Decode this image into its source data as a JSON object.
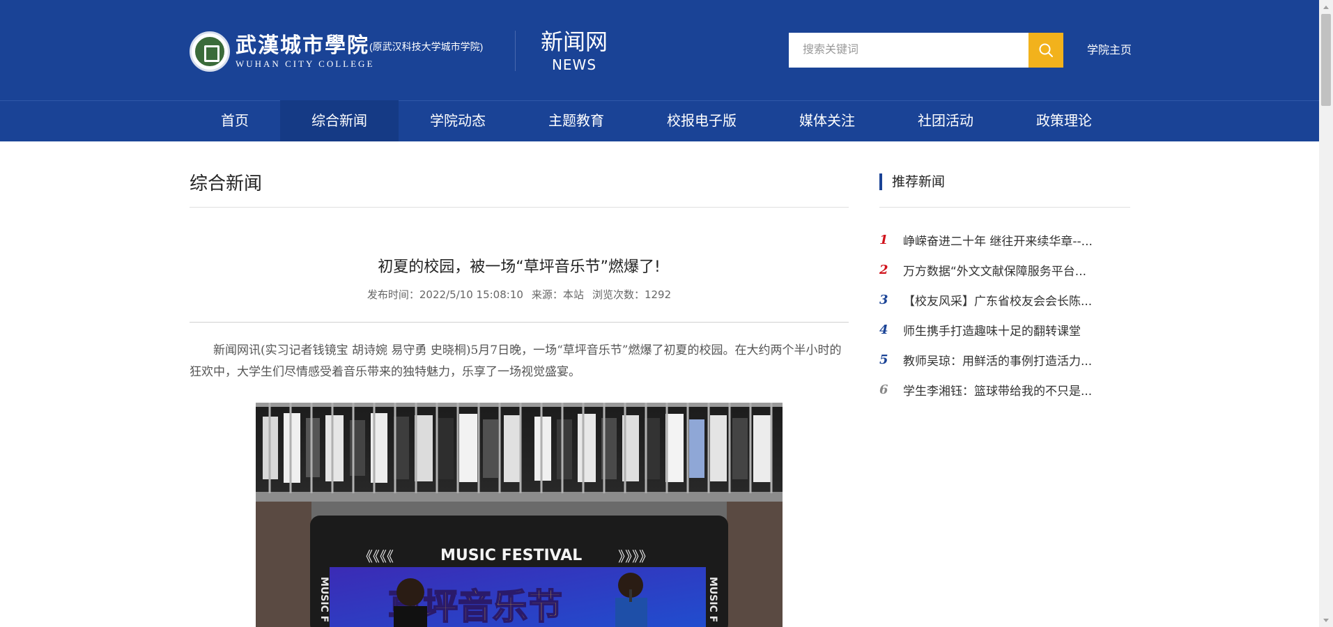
{
  "header": {
    "logo_cn": "武漢城市學院",
    "logo_paren": "(原武汉科技大学城市学院)",
    "logo_en": "WUHAN CITY COLLEGE",
    "site_name_cn": "新闻网",
    "site_name_en": "NEWS",
    "search": {
      "placeholder": "搜索关键词",
      "value": "",
      "icon": "search-icon"
    },
    "home_link": "学院主页"
  },
  "nav": {
    "items": [
      {
        "label": "首页",
        "active": false
      },
      {
        "label": "综合新闻",
        "active": true
      },
      {
        "label": "学院动态",
        "active": false
      },
      {
        "label": "主题教育",
        "active": false
      },
      {
        "label": "校报电子版",
        "active": false
      },
      {
        "label": "媒体关注",
        "active": false
      },
      {
        "label": "社团活动",
        "active": false
      },
      {
        "label": "政策理论",
        "active": false
      }
    ]
  },
  "main": {
    "section_title": "综合新闻",
    "article": {
      "title": "初夏的校园，被一场“草坪音乐节”燃爆了!",
      "publish_time": "发布时间：2022/5/10 15:08:10",
      "source": "来源：本站",
      "views": "浏览次数：1292",
      "paragraph": "新闻网讯(实习记者钱镜宝  胡诗婉  易守勇  史晓桐)5月7日晚，一场“草坪音乐节”燃爆了初夏的校园。在大约两个半小时的狂欢中，大学生们尽情感受着音乐带来的独特魅力，乐享了一场视觉盛宴。",
      "photo": {
        "banner_top": "MUSIC FESTIVAL",
        "banner_main": "草坪音乐节",
        "banner_side": "MUSIC F",
        "arrows_left": "《《《《",
        "arrows_right": "》》》》"
      }
    }
  },
  "sidebar": {
    "heading": "推荐新闻",
    "items": [
      {
        "num": "1",
        "title": "峥嵘奋进二十年 继往开来续华章--...",
        "color": "#d0121b"
      },
      {
        "num": "2",
        "title": "万方数据“外文文献保障服务平台...",
        "color": "#d0121b"
      },
      {
        "num": "3",
        "title": "【校友风采】广东省校友会会长陈...",
        "color": "#1a4396"
      },
      {
        "num": "4",
        "title": "师生携手打造趣味十足的翻转课堂",
        "color": "#1a4396"
      },
      {
        "num": "5",
        "title": "教师吴琼：用鲜活的事例打造活力...",
        "color": "#1a4396"
      },
      {
        "num": "6",
        "title": "学生李湘钰：篮球带给我的不只是...",
        "color": "#888888"
      }
    ]
  },
  "colors": {
    "primary": "#1a4396",
    "nav_active": "#153a85",
    "search_button": "#f2b21c"
  }
}
